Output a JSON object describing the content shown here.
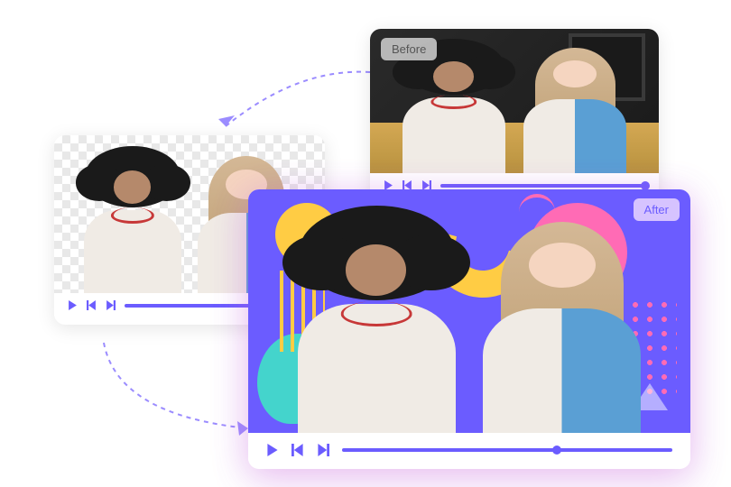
{
  "badges": {
    "before": "Before",
    "after": "After"
  },
  "colors": {
    "accent": "#6b5cff",
    "pink": "#ff6bb5",
    "yellow": "#ffcc44",
    "teal": "#44d4cc"
  }
}
